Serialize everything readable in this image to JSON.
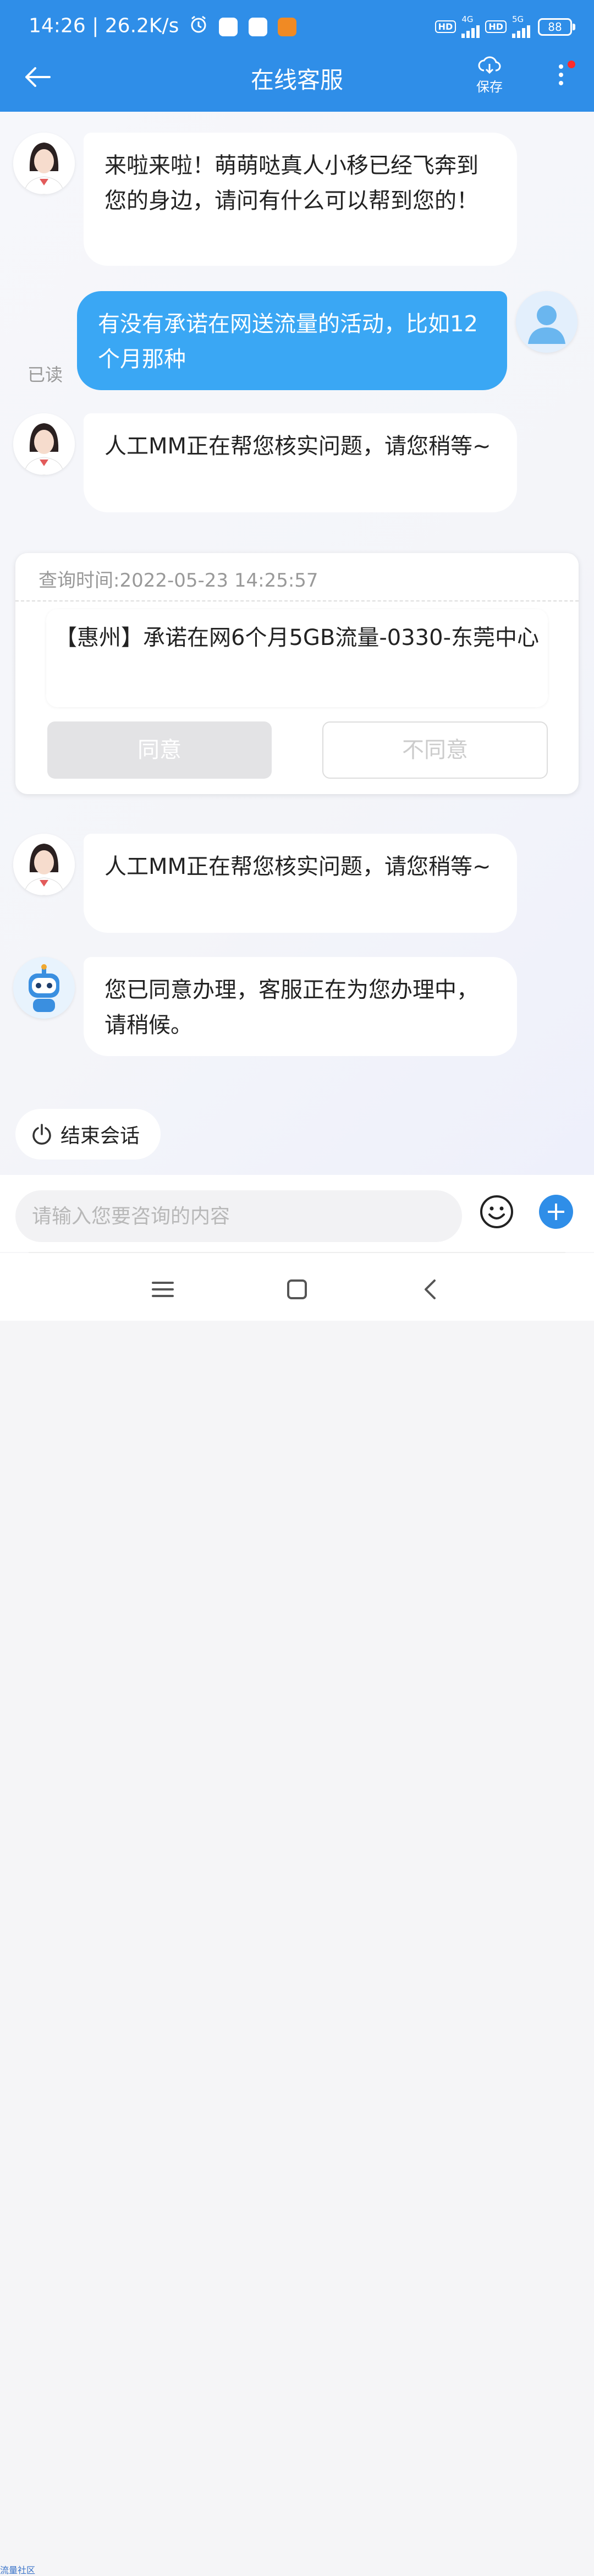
{
  "status_bar": {
    "time_speed": "14:26 | 26.2K/s",
    "hd1": "HD",
    "net1": "4G",
    "hd2": "HD",
    "net2": "5G",
    "battery": "88"
  },
  "header": {
    "title": "在线客服",
    "save_label": "保存"
  },
  "messages": [
    {
      "from": "agent",
      "avatar": "agent-photo",
      "text": "来啦来啦！萌萌哒真人小移已经飞奔到您的身边，请问有什么可以帮到您的！"
    },
    {
      "from": "user",
      "avatar": "user-default",
      "text": "有没有承诺在网送流量的活动，比如12个月那种",
      "read_label": "已读"
    },
    {
      "from": "agent",
      "avatar": "agent-photo",
      "text": "人工MM正在帮您核实问题，请您稍等~"
    },
    {
      "from": "agent",
      "avatar": "agent-photo",
      "text": "人工MM正在帮您核实问题，请您稍等~"
    },
    {
      "from": "bot",
      "avatar": "robot",
      "text": "您已同意办理，客服正在为您办理中，请稍候。"
    }
  ],
  "offer_card": {
    "query_time": "查询时间:2022-05-23 14:25:57",
    "offer_text": "【惠州】承诺在网6个月5GB流量-0330-东莞中心",
    "agree_label": "同意",
    "disagree_label": "不同意"
  },
  "end_session_label": "结束会话",
  "input": {
    "placeholder": "请输入您要咨询的内容"
  },
  "watermark": "流量社区",
  "colors": {
    "header_bg": "#2f8ee8",
    "user_bubble": "#3aa7f4",
    "notify_dot": "#ff2b2b"
  }
}
